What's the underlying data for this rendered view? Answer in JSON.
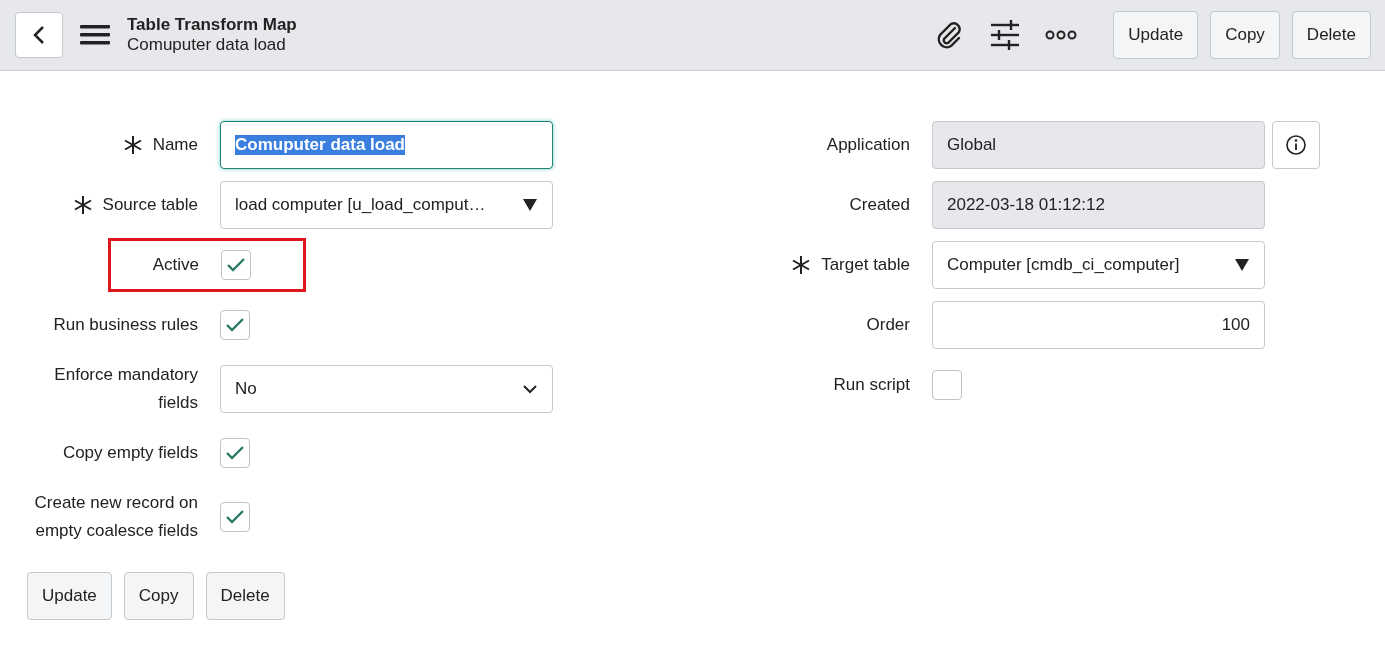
{
  "header": {
    "title": "Table Transform Map",
    "subtitle": "Comuputer data load",
    "buttons": [
      "Update",
      "Copy",
      "Delete"
    ]
  },
  "left_fields": [
    {
      "label": "Name",
      "required": true,
      "kind": "text",
      "value": "Comuputer data load",
      "focused": true,
      "text_selected": true
    },
    {
      "label": "Source table",
      "required": true,
      "kind": "reference",
      "value": "load computer [u_load_comput…"
    },
    {
      "label": "Active",
      "required": false,
      "kind": "checkbox",
      "checked": true,
      "highlighted": true
    },
    {
      "label": "Run business rules",
      "required": false,
      "kind": "checkbox",
      "checked": true,
      "highlighted": false
    },
    {
      "label": "Enforce mandatory fields",
      "required": false,
      "kind": "choice",
      "value": "No"
    },
    {
      "label": "Copy empty fields",
      "required": false,
      "kind": "checkbox",
      "checked": true,
      "highlighted": false
    },
    {
      "label": "Create new record on empty coalesce fields",
      "required": false,
      "kind": "checkbox",
      "checked": true,
      "highlighted": false
    }
  ],
  "right_fields": [
    {
      "label": "Application",
      "required": false,
      "kind": "readonly",
      "value": "Global",
      "info": true
    },
    {
      "label": "Created",
      "required": false,
      "kind": "readonly",
      "value": "2022-03-18 01:12:12",
      "info": false
    },
    {
      "label": "Target table",
      "required": true,
      "kind": "reference",
      "value": "Computer [cmdb_ci_computer]"
    },
    {
      "label": "Order",
      "required": false,
      "kind": "number",
      "value": "100"
    },
    {
      "label": "Run script",
      "required": false,
      "kind": "checkbox",
      "checked": false,
      "highlighted": false
    }
  ],
  "footer_buttons": [
    "Update",
    "Copy",
    "Delete"
  ]
}
